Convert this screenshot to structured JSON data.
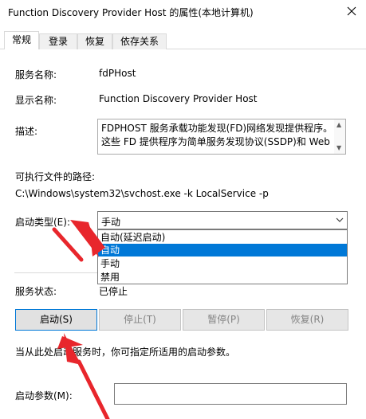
{
  "window": {
    "title": "Function Discovery Provider Host 的属性(本地计算机)",
    "close_icon": "close-icon"
  },
  "tabs": [
    {
      "label": "常规",
      "active": true
    },
    {
      "label": "登录",
      "active": false
    },
    {
      "label": "恢复",
      "active": false
    },
    {
      "label": "依存关系",
      "active": false
    }
  ],
  "general": {
    "service_name_label": "服务名称:",
    "service_name": "fdPHost",
    "display_name_label": "显示名称:",
    "display_name": "Function Discovery Provider Host",
    "description_label": "描述:",
    "description_lines": [
      "FDPHOST 服务承载功能发现(FD)网络发现提供程序。",
      "这些 FD 提供程序为简单服务发现协议(SSDP)和 Web"
    ],
    "exe_path_label": "可执行文件的路径:",
    "exe_path": "C:\\Windows\\system32\\svchost.exe -k LocalService -p",
    "startup_type_label": "启动类型(E):",
    "startup_type_value": "手动",
    "startup_options": [
      {
        "label": "自动(延迟启动)",
        "selected": false
      },
      {
        "label": "自动",
        "selected": true
      },
      {
        "label": "手动",
        "selected": false
      },
      {
        "label": "禁用",
        "selected": false
      }
    ],
    "service_status_label": "服务状态:",
    "service_status": "已停止",
    "buttons": {
      "start": "启动(S)",
      "stop": "停止(T)",
      "pause": "暂停(P)",
      "resume": "恢复(R)"
    },
    "hint": "当从此处启动服务时，你可指定所适用的启动参数。",
    "start_params_label": "启动参数(M):",
    "start_params_value": ""
  },
  "colors": {
    "selection": "#0078d7",
    "annotation_arrow": "#e8262c"
  }
}
